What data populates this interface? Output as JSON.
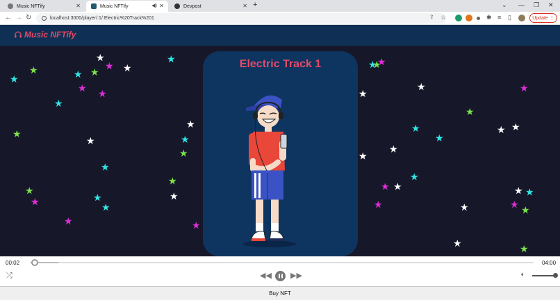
{
  "browser": {
    "tabs": [
      {
        "title": "Music NFTify",
        "active": false
      },
      {
        "title": "Music NFTify",
        "active": true
      },
      {
        "title": "Devpost",
        "active": false
      }
    ],
    "new_tab_glyph": "+",
    "url": "localhost:3000/player/:1/:Electric%20Track%201",
    "update_label": "Update"
  },
  "app": {
    "brand": "Music NFTify",
    "brand_icon": "headphones-icon",
    "accent_color": "#e04a66"
  },
  "player": {
    "track_title": "Electric Track 1",
    "current_time": "00:02",
    "duration": "04:00",
    "progress_fraction": 0.008,
    "volume_fraction": 1.0,
    "buy_label": "Buy NFT",
    "state": "playing"
  },
  "colors": {
    "header_bg": "#0f2f54",
    "stage_bg": "#161829",
    "card_bg": "#0e3460",
    "star_colors": [
      "#ffffff",
      "#2ee6e6",
      "#e02ed8",
      "#7be04a"
    ]
  }
}
